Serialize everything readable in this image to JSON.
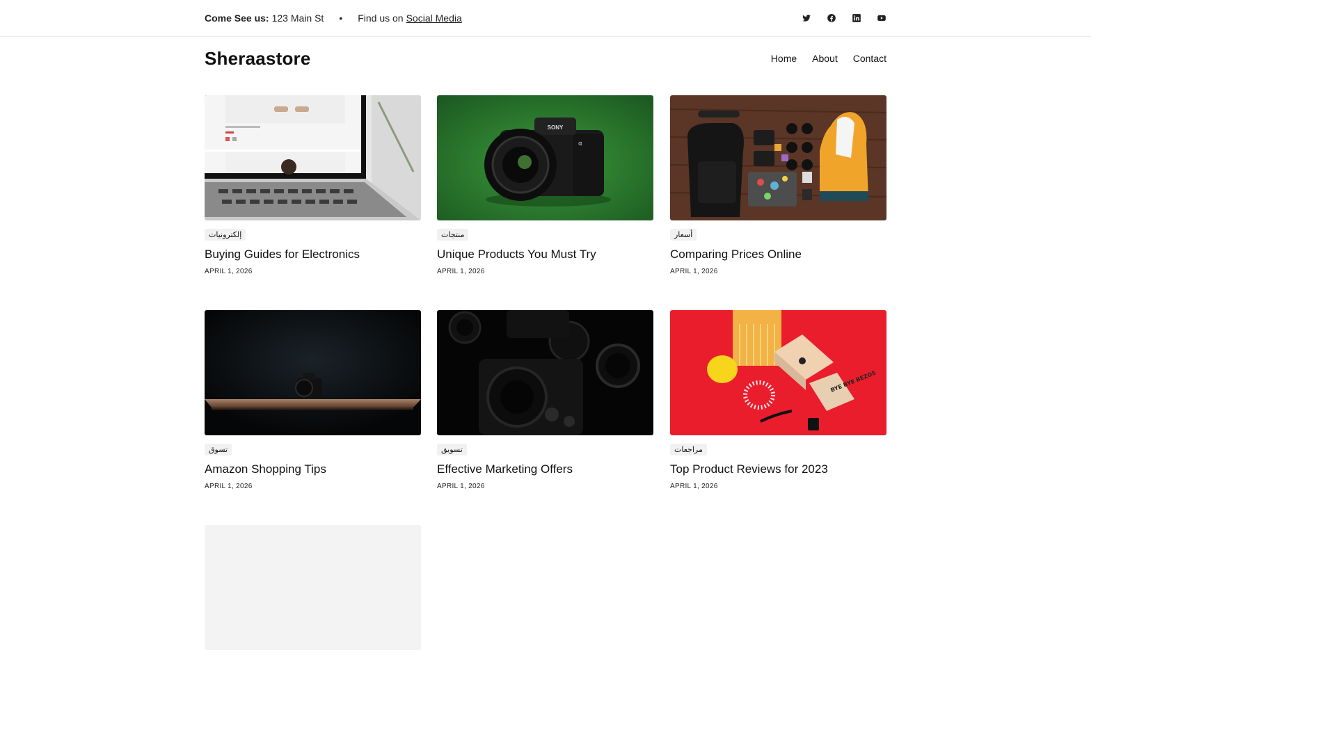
{
  "topbar": {
    "visit_label": "Come See us:",
    "address": "123 Main St",
    "separator": "•",
    "find_text": "Find us on",
    "social_link": "Social Media",
    "social_icons": [
      "twitter-icon",
      "facebook-icon",
      "linkedin-icon",
      "youtube-icon"
    ]
  },
  "header": {
    "brand": "Sheraastore",
    "nav": [
      "Home",
      "About",
      "Contact"
    ]
  },
  "posts": [
    {
      "tag": "إلكترونيات",
      "title": "Buying Guides for Electronics",
      "date": "APRIL 1, 2026"
    },
    {
      "tag": "منتجات",
      "title": "Unique Products You Must Try",
      "date": "APRIL 1, 2026"
    },
    {
      "tag": "أسعار",
      "title": "Comparing Prices Online",
      "date": "APRIL 1, 2026"
    },
    {
      "tag": "تسوق",
      "title": "Amazon Shopping Tips",
      "date": "APRIL 1, 2026"
    },
    {
      "tag": "تسويق",
      "title": "Effective Marketing Offers",
      "date": "APRIL 1, 2026"
    },
    {
      "tag": "مراجعات",
      "title": "Top Product Reviews for 2023",
      "date": "APRIL 1, 2026"
    }
  ],
  "images": {
    "camera_brand": "SONY",
    "camera_model": "α",
    "box_text": "BYE BYE BEZOS"
  },
  "colors": {
    "green_bg": "#2a7a2a",
    "red_bg": "#ea1d2c",
    "wood": "#5b3526",
    "placeholder": "#f3f3f3"
  }
}
